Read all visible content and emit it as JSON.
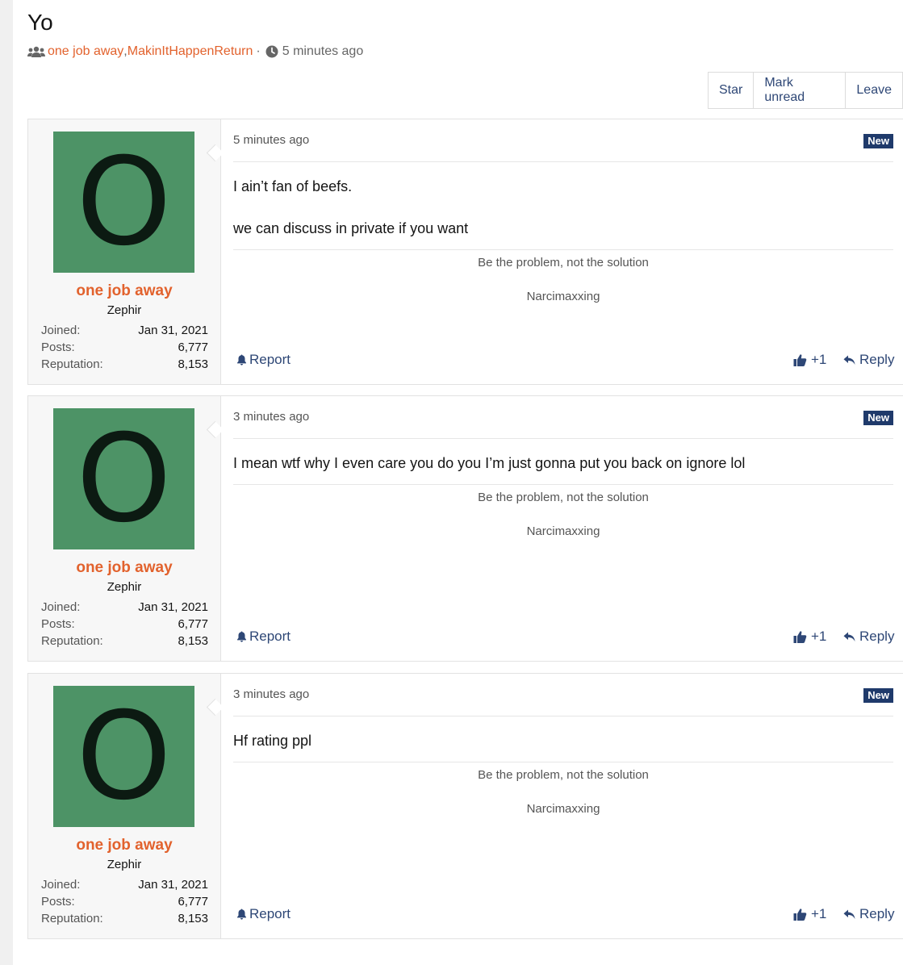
{
  "thread": {
    "title": "Yo",
    "participants": [
      "one job away",
      "MakinItHappenReturn"
    ],
    "separator": ", ",
    "dot": "·",
    "time": "5 minutes ago"
  },
  "actions": {
    "star": "Star",
    "mark_unread": "Mark unread",
    "leave": "Leave"
  },
  "posts": [
    {
      "avatar_letter": "O",
      "username": "one job away",
      "user_title": "Zephir",
      "stats": {
        "joined_label": "Joined:",
        "joined": "Jan 31, 2021",
        "posts_label": "Posts:",
        "posts": "6,777",
        "rep_label": "Reputation:",
        "rep": "8,153"
      },
      "time": "5 minutes ago",
      "badge": "New",
      "paragraphs": [
        "I ain’t fan of beefs.",
        "we can discuss in private if you want"
      ],
      "signature_line1": "Be the problem, not the solution",
      "signature_line2": "Narcimaxxing",
      "report": "Report",
      "like": "+1",
      "reply": "Reply"
    },
    {
      "avatar_letter": "O",
      "username": "one job away",
      "user_title": "Zephir",
      "stats": {
        "joined_label": "Joined:",
        "joined": "Jan 31, 2021",
        "posts_label": "Posts:",
        "posts": "6,777",
        "rep_label": "Reputation:",
        "rep": "8,153"
      },
      "time": "3 minutes ago",
      "badge": "New",
      "paragraphs": [
        "I mean wtf why I even care you do you I’m just gonna put you back on ignore lol"
      ],
      "signature_line1": "Be the problem, not the solution",
      "signature_line2": "Narcimaxxing",
      "report": "Report",
      "like": "+1",
      "reply": "Reply"
    },
    {
      "avatar_letter": "O",
      "username": "one job away",
      "user_title": "Zephir",
      "stats": {
        "joined_label": "Joined:",
        "joined": "Jan 31, 2021",
        "posts_label": "Posts:",
        "posts": "6,777",
        "rep_label": "Reputation:",
        "rep": "8,153"
      },
      "time": "3 minutes ago",
      "badge": "New",
      "paragraphs": [
        "Hf rating ppl"
      ],
      "signature_line1": "Be the problem, not the solution",
      "signature_line2": "Narcimaxxing",
      "report": "Report",
      "like": "+1",
      "reply": "Reply"
    }
  ],
  "colors": {
    "accent": "#e2622d",
    "link": "#2e4776",
    "badge_bg": "#1f3a6b",
    "avatar_bg": "#4d9366"
  }
}
